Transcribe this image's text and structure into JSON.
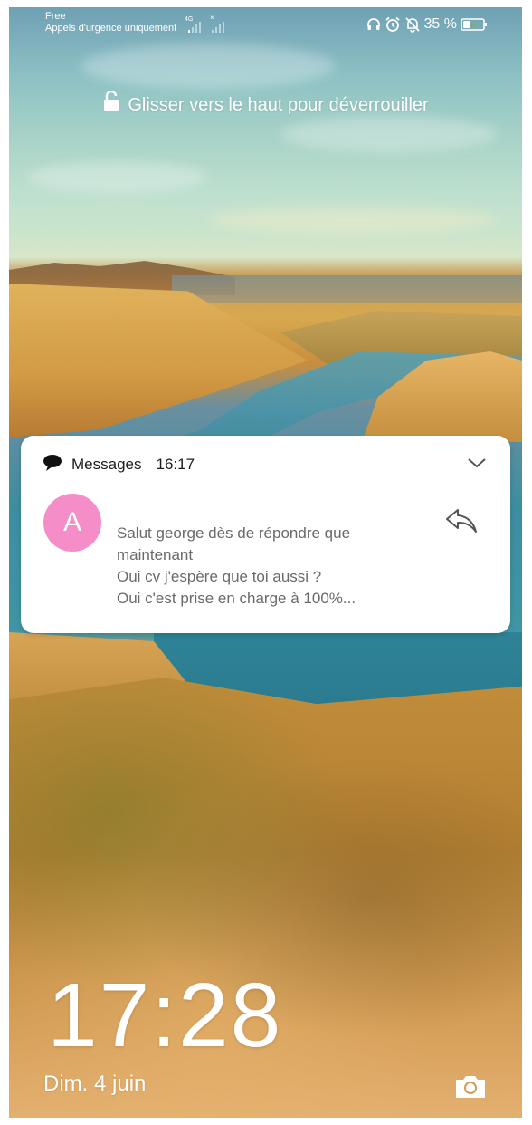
{
  "status_bar": {
    "carrier": "Free",
    "emergency_text": "Appels d'urgence uniquement",
    "network_type": "4G",
    "battery_percent": "35 %",
    "battery_level": 0.35,
    "icons": [
      "headphones-icon",
      "alarm-icon",
      "muted-bell-icon",
      "battery-icon",
      "signal-icon"
    ]
  },
  "lock_screen": {
    "unlock_hint": "Glisser vers le haut pour déverrouiller",
    "time": "17:28",
    "date": "Dim. 4 juin"
  },
  "notification": {
    "app_name": "Messages",
    "time": "16:17",
    "avatar_letter": "A",
    "avatar_color": "#f58ec8",
    "lines": [
      "Salut george dès de répondre que",
      "maintenant",
      "Oui cv j'espère que toi aussi ?",
      "Oui c'est prise en charge à 100%..."
    ]
  }
}
